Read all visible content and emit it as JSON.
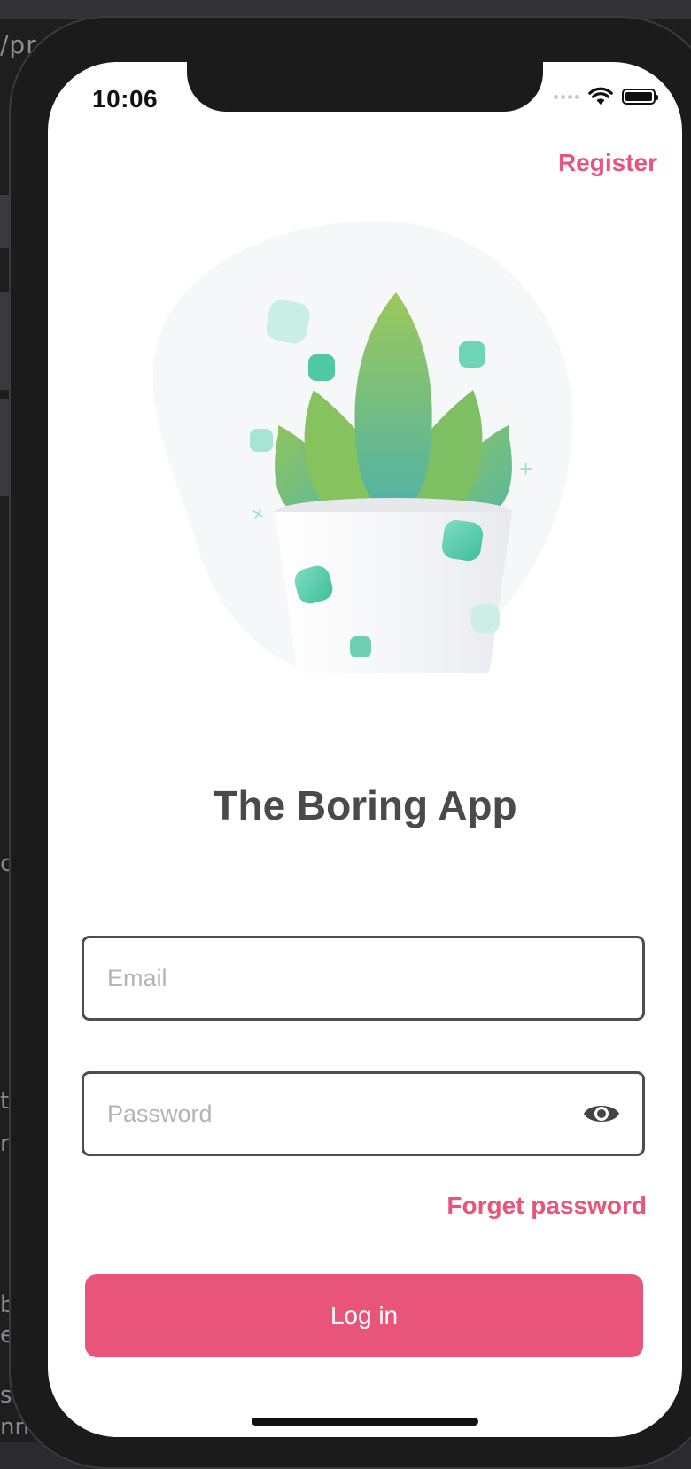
{
  "background": {
    "url_fragment": "/pr",
    "fragments": [
      "c",
      "t",
      "re",
      "b",
      "e",
      "ss",
      "nne"
    ]
  },
  "status_bar": {
    "time": "10:06",
    "icons": [
      "signal-dots-icon",
      "wifi-icon",
      "battery-icon"
    ]
  },
  "header": {
    "register_label": "Register"
  },
  "illustration": {
    "subject": "potted-plant-icon"
  },
  "app": {
    "title": "The Boring App"
  },
  "form": {
    "email_placeholder": "Email",
    "password_placeholder": "Password",
    "email_value": "",
    "password_value": "",
    "show_password_icon": "eye-icon",
    "forgot_label": "Forget password",
    "login_label": "Log in"
  },
  "colors": {
    "accent": "#e9557a",
    "title": "#4a4a4a",
    "field_border": "#4d4d4d",
    "placeholder": "#b4b4b8",
    "plant_green": "#8cc35a",
    "plant_teal": "#4fb7a6"
  }
}
